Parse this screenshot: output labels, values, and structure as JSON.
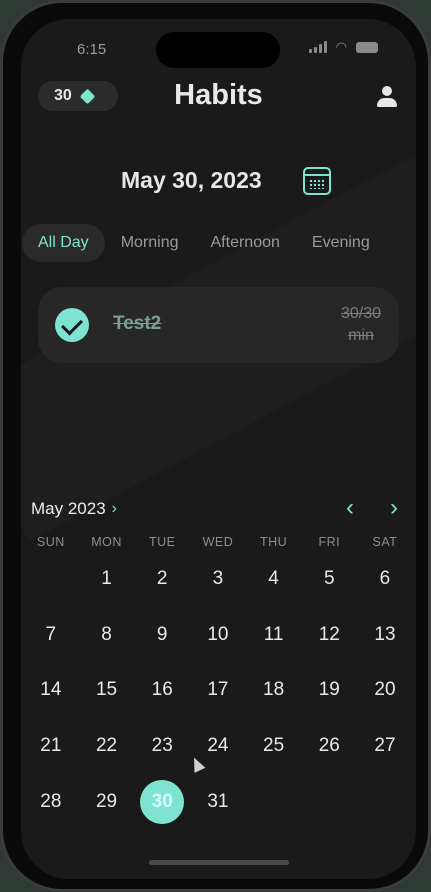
{
  "status": {
    "time": "6:15"
  },
  "header": {
    "gem_count": "30",
    "title": "Habits"
  },
  "date_title": "May 30, 2023",
  "tabs": [
    {
      "label": "All Day",
      "active": true
    },
    {
      "label": "Morning",
      "active": false
    },
    {
      "label": "Afternoon",
      "active": false
    },
    {
      "label": "Evening",
      "active": false
    }
  ],
  "habit": {
    "name": "Test2",
    "progress_value": "30/30",
    "progress_unit": "min",
    "completed": true
  },
  "calendar": {
    "month_label": "May 2023",
    "weekdays": [
      "SUN",
      "MON",
      "TUE",
      "WED",
      "THU",
      "FRI",
      "SAT"
    ],
    "first_weekday_index": 1,
    "days": [
      "1",
      "2",
      "3",
      "4",
      "5",
      "6",
      "7",
      "8",
      "9",
      "10",
      "11",
      "12",
      "13",
      "14",
      "15",
      "16",
      "17",
      "18",
      "19",
      "20",
      "21",
      "22",
      "23",
      "24",
      "25",
      "26",
      "27",
      "28",
      "29",
      "30",
      "31"
    ],
    "selected_day": "30"
  },
  "colors": {
    "accent": "#7fe3d2",
    "background": "#1a1a1a",
    "card": "#272727"
  },
  "icons": {
    "gem": "diamond-icon",
    "profile": "profile-icon",
    "calendar": "calendar-icon",
    "check": "check-icon"
  }
}
